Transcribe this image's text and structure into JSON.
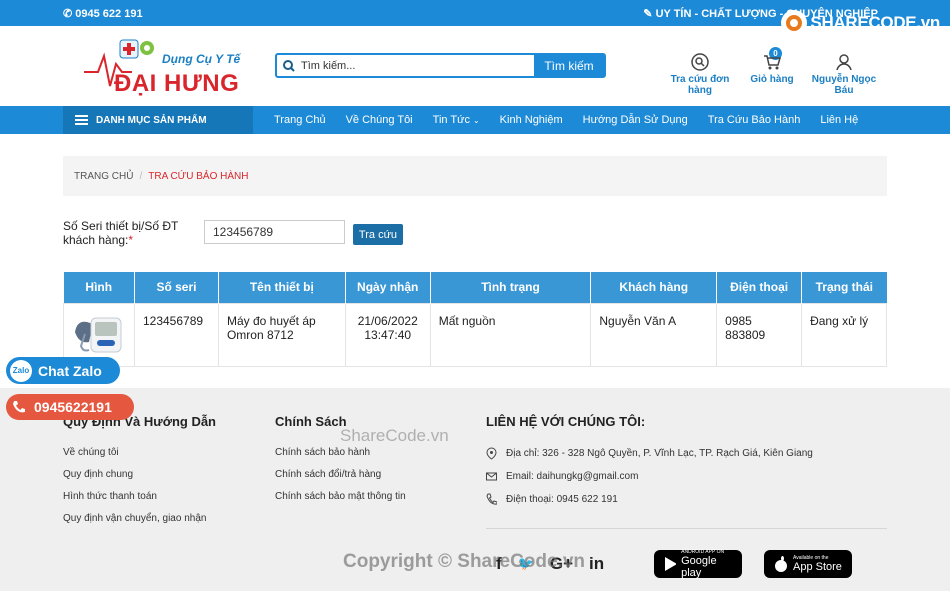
{
  "topbar": {
    "phone": "0945 622 191",
    "slogan": "UY TÍN - CHẤT LƯỢNG - CHUYÊN NGHIỆP",
    "watermark_logo": "SHARECODE.vn"
  },
  "logo": {
    "sub": "Dụng Cụ Y Tế",
    "main": "ĐẠI HƯNG"
  },
  "search": {
    "placeholder": "Tìm kiếm...",
    "button": "Tìm kiếm"
  },
  "header_icons": {
    "order_lookup": "Tra cứu đơn hàng",
    "cart": "Giỏ hàng",
    "cart_count": "0",
    "user": "Nguyễn Ngọc Báu"
  },
  "nav": {
    "category_button": "DANH MỤC SẢN PHẨM",
    "links": [
      "Trang Chủ",
      "Về Chúng Tôi",
      "Tin Tức",
      "Kinh Nghiệm",
      "Hướng Dẫn Sử Dụng",
      "Tra Cứu Bảo Hành",
      "Liên Hệ"
    ]
  },
  "breadcrumb": {
    "home": "TRANG CHỦ",
    "separator": "/",
    "current": "TRA CỨU BẢO HÀNH"
  },
  "lookup_form": {
    "label": "Số Seri thiết bị/Số ĐT khách hàng:",
    "required_mark": "*",
    "value": "123456789",
    "button": "Tra cứu"
  },
  "table": {
    "headers": [
      "Hình",
      "Số seri",
      "Tên thiết bị",
      "Ngày nhận",
      "Tình trạng",
      "Khách hàng",
      "Điện thoại",
      "Trạng thái"
    ],
    "rows": [
      {
        "serial": "123456789",
        "device": "Máy đo huyết áp Omron 8712",
        "received_date": "21/06/2022",
        "received_time": "13:47:40",
        "condition": "Mất nguồn",
        "customer": "Nguyễn Văn A",
        "phone": "0985 883809",
        "status": "Đang xử lý"
      }
    ]
  },
  "footer": {
    "col1": {
      "title": "Quy Định Và Hướng Dẫn",
      "items": [
        "Về chúng tôi",
        "Quy định chung",
        "Hình thức thanh toán",
        "Quy định vận chuyển, giao nhận"
      ]
    },
    "col2": {
      "title": "Chính Sách",
      "items": [
        "Chính sách bảo hành",
        "Chính sách đổi/trả hàng",
        "Chính sách bảo mật thông tin"
      ]
    },
    "col3": {
      "title": "LIÊN HỆ VỚI CHÚNG TÔI:",
      "address": "Địa chỉ: 326 - 328 Ngô Quyền, P. Vĩnh Lạc, TP. Rạch Giá, Kiên Giang",
      "email": "Email: daihungkg@gmail.com",
      "phone": "Điện thoại: 0945 622 191"
    },
    "social_icons": [
      "f",
      "🐦",
      "G+",
      "in"
    ],
    "google_play": {
      "small": "ANDROID APP ON",
      "big": "Google play"
    },
    "app_store": {
      "small": "Available on the",
      "big": "App Store"
    }
  },
  "floating": {
    "zalo": "Chat Zalo",
    "zalo_badge": "Zalo",
    "hotline": "0945622191"
  },
  "watermarks": {
    "middle": "ShareCode.vn",
    "bottom": "Copyright © ShareCode.vn"
  }
}
